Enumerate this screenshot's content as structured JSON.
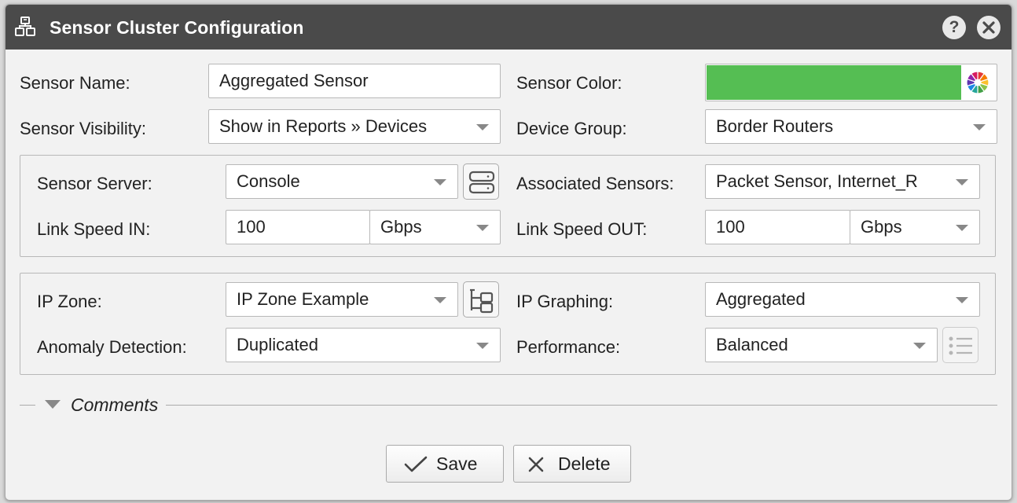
{
  "window": {
    "title": "Sensor Cluster Configuration",
    "icon": "sensor-cluster-icon",
    "help_label": "?",
    "help_icon": "help-icon",
    "close_icon": "close-icon"
  },
  "general": {
    "sensor_name_label": "Sensor Name:",
    "sensor_name_value": "Aggregated Sensor",
    "sensor_color_label": "Sensor Color:",
    "sensor_color_value": "#55be53",
    "sensor_color_picker_icon": "color-wheel-icon",
    "sensor_visibility_label": "Sensor Visibility:",
    "sensor_visibility_value": "Show in Reports » Devices",
    "device_group_label": "Device Group:",
    "device_group_value": "Border Routers"
  },
  "server_group": {
    "sensor_server_label": "Sensor Server:",
    "sensor_server_value": "Console",
    "sensor_server_button_icon": "server-icon",
    "associated_sensors_label": "Associated Sensors:",
    "associated_sensors_value": "Packet Sensor, Internet_R",
    "link_speed_in_label": "Link Speed IN:",
    "link_speed_in_value": "100",
    "link_speed_in_unit": "Gbps",
    "link_speed_out_label": "Link Speed OUT:",
    "link_speed_out_value": "100",
    "link_speed_out_unit": "Gbps"
  },
  "ip_group": {
    "ip_zone_label": "IP Zone:",
    "ip_zone_value": "IP Zone Example",
    "ip_zone_button_icon": "tree-icon",
    "ip_graphing_label": "IP Graphing:",
    "ip_graphing_value": "Aggregated",
    "anomaly_detection_label": "Anomaly Detection:",
    "anomaly_detection_value": "Duplicated",
    "performance_label": "Performance:",
    "performance_value": "Balanced",
    "performance_button_icon": "list-icon"
  },
  "comments": {
    "label": "Comments",
    "toggle_icon": "caret-down-icon"
  },
  "actions": {
    "save_label": "Save",
    "save_icon": "check-icon",
    "delete_label": "Delete",
    "delete_icon": "x-icon"
  },
  "colors": {
    "titlebar": "#4a4a4a",
    "background": "#f2f2f2",
    "border": "#b8b8b8"
  }
}
